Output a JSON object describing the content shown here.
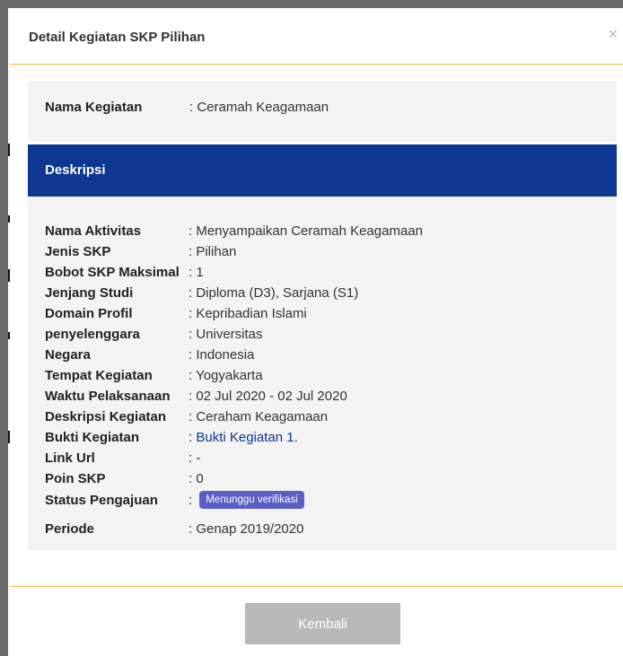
{
  "modal": {
    "title": "Detail Kegiatan SKP Pilihan",
    "close_label": "×"
  },
  "name": {
    "label": "Nama Kegiatan",
    "separator": ":",
    "value": "Ceramah Keagamaan"
  },
  "description": {
    "header": "Deskripsi",
    "rows": [
      {
        "label": "Nama Aktivitas",
        "value": ": Menyampaikan Ceramah Keagamaan"
      },
      {
        "label": "Jenis SKP",
        "value": ": Pilihan"
      },
      {
        "label": "Bobot SKP Maksimal",
        "value": ": 1"
      },
      {
        "label": "Jenjang Studi",
        "value": ": Diploma (D3), Sarjana (S1)"
      },
      {
        "label": "Domain Profil",
        "value": ": Kepribadian Islami"
      },
      {
        "label": "penyelenggara",
        "value": ": Universitas"
      },
      {
        "label": "Negara",
        "value": ": Indonesia"
      },
      {
        "label": "Tempat Kegiatan",
        "value": ": Yogyakarta"
      },
      {
        "label": "Waktu Pelaksanaan",
        "value": ": 02 Jul 2020 - 02 Jul 2020"
      },
      {
        "label": "Deskripsi Kegiatan",
        "value": ": Ceraham Keagamaan"
      },
      {
        "label": "Bukti Kegiatan",
        "value_prefix": ":",
        "link": "Bukti Kegiatan 1."
      },
      {
        "label": "Link Url",
        "value": ": -"
      },
      {
        "label": "Poin SKP",
        "value": ": 0"
      },
      {
        "label": "Status Pengajuan",
        "value_prefix": ":",
        "badge": "Menunggu verifikasi"
      },
      {
        "label": "Periode",
        "value": ": Genap 2019/2020"
      }
    ]
  },
  "footer": {
    "back_label": "Kembali"
  },
  "colors": {
    "header_bg": "#0d3791",
    "accent_line": "#f0c23a",
    "badge_bg": "#5a5fc4",
    "button_bg": "#b9b9b9",
    "link": "#0d3791"
  }
}
